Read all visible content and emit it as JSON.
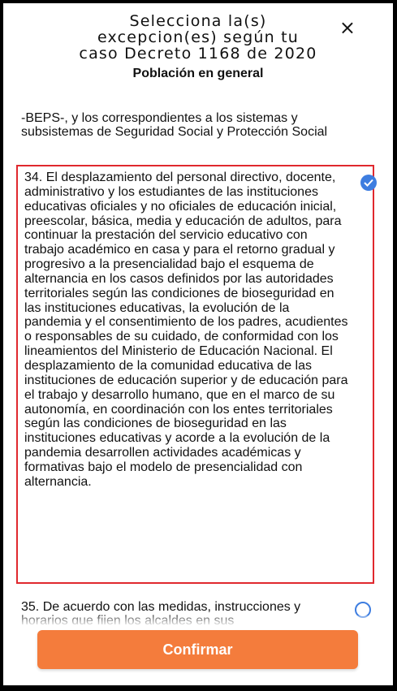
{
  "dialog": {
    "title": "Selecciona la(s) excepcion(es) según tu caso Decreto 1168 de 2020",
    "close_icon": "×",
    "subtitle": "Población en general"
  },
  "list": {
    "top_text": "-BEPS-, y los correspondientes a los sistemas y subsistemas de Seguridad Social y Protección Social",
    "items": [
      {
        "text": "34. El desplazamiento del personal directivo, docente, administrativo y los estudiantes de las instituciones educativas oficiales y no oficiales de educación inicial, preescolar, básica, media y educación de adultos, para continuar la prestación del servicio educativo con trabajo académico en casa y para el retorno gradual y progresivo a la presencialidad bajo el esquema de alternancia en los casos definidos por las autoridades territoriales según las condiciones de bioseguridad en las instituciones educativas, la evolución de la pandemia y el consentimiento de los padres, acudientes o responsables de su cuidado, de conformidad con los lineamientos del Ministerio de Educación Nacional. El desplazamiento de la comunidad educativa de las instituciones de educación superior y de educación para el trabajo y desarrollo humano, que en el marco de su autonomía, en coordinación con los entes territoriales según las condiciones de bioseguridad en las instituciones educativas y acorde a la evolución de la pandemia desarrollen actividades académicas y formativas bajo el modelo de presencialidad con alternancia.",
        "selected": true
      },
      {
        "text": "35. De acuerdo con las medidas, instrucciones y horarios que fijen los alcaldes en sus",
        "selected": false
      }
    ]
  },
  "footer": {
    "confirm_label": "Confirmar"
  },
  "colors": {
    "accent_orange": "#f47c3c",
    "selection_border": "#e0282e",
    "check_blue": "#3d7de0"
  },
  "icons": [
    "close-icon",
    "checkmark-icon",
    "radio-unselected-icon"
  ]
}
